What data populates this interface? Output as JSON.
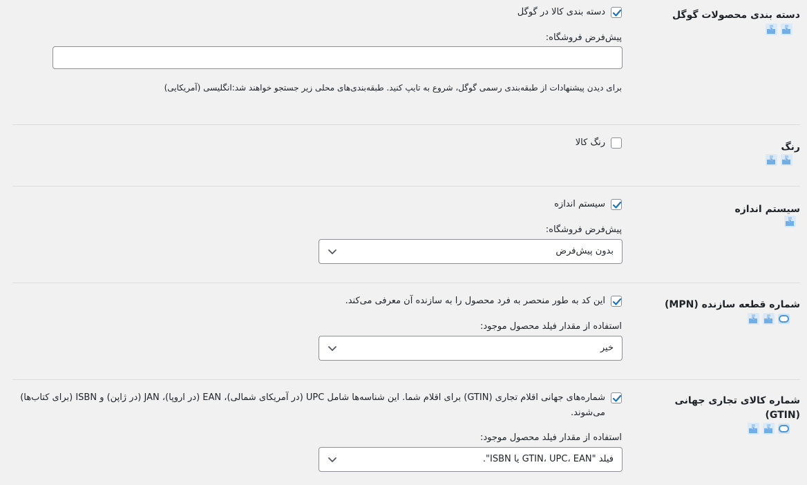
{
  "sections": [
    {
      "label": "دسته بندی محصولات گوگل",
      "checkbox_label": "دسته بندی کالا در گوگل",
      "checked": true,
      "sub_label": "پیش‌فرض فروشگاه:",
      "input_value": "",
      "help_text": "برای دیدن پیشنهادات از طبقه‌بندی رسمی گوگل، شروع به تایپ کنید. طبقه‌بندی‌های محلی زیر جستجو خواهند شد:انگلیسی (آمریکایی)",
      "icons": [
        "puzzle-icon",
        "puzzle-icon"
      ]
    },
    {
      "label": "رنگ",
      "checkbox_label": "رنگ کالا",
      "checked": false,
      "icons": [
        "puzzle-icon",
        "puzzle-icon"
      ]
    },
    {
      "label": "سیستم اندازه",
      "checkbox_label": "سیستم اندازه",
      "checked": true,
      "sub_label": "پیش‌فرض فروشگاه:",
      "select_value": "بدون پیش‌فرض",
      "icons": [
        "puzzle-icon"
      ]
    },
    {
      "label": "شماره قطعه سازنده (MPN)",
      "checkbox_label": "این کد به طور منحصر به فرد محصول را به سازنده آن معرفی می‌کند.",
      "checked": true,
      "sub_label": "استفاده از مقدار فیلد محصول موجود:",
      "select_value": "خیر",
      "icons": [
        "puzzle-icon",
        "puzzle-icon",
        "bing-icon"
      ]
    },
    {
      "label": "شماره کالای تجاری جهانی (GTIN)",
      "checkbox_label": "شماره‌های جهانی اقلام تجاری (GTIN) برای اقلام شما. این شناسه‌ها شامل UPC (در آمریکای شمالی)، EAN (در اروپا)، JAN (در ژاپن) و ISBN (برای کتاب‌ها) می‌شوند.",
      "checked": true,
      "sub_label": "استفاده از مقدار فیلد محصول موجود:",
      "select_value": "فیلد \"GTIN، UPC، EAN یا ISBN\".",
      "icons": [
        "puzzle-icon",
        "puzzle-icon",
        "bing-icon"
      ]
    }
  ],
  "colors": {
    "accent": "#2271b1",
    "icon_blue": "#72aee6",
    "border": "#8c8f94",
    "separator": "#dcdcde"
  }
}
